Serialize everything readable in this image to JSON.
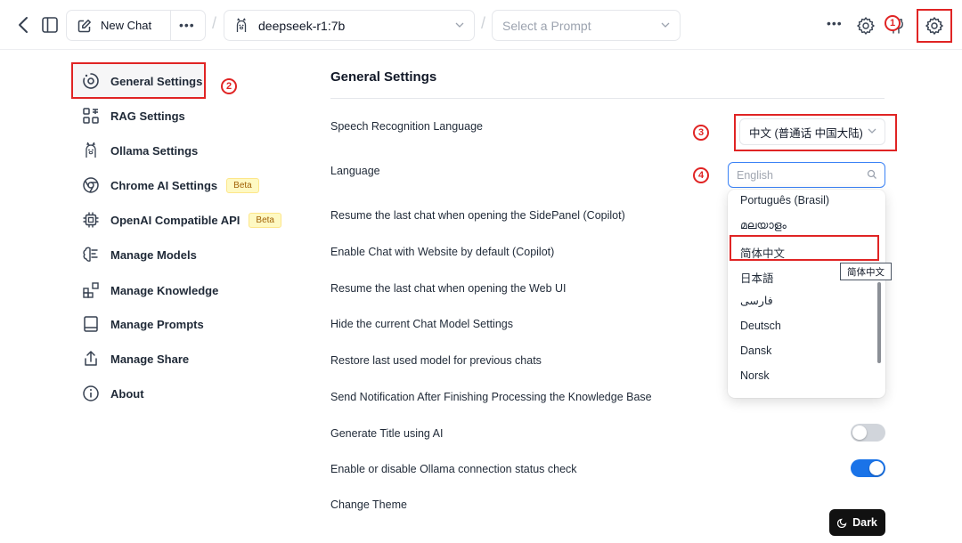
{
  "topbar": {
    "new_chat_label": "New Chat",
    "more_label": "•••",
    "model_label": "deepseek-r1:7b",
    "prompt_placeholder": "Select a Prompt",
    "overflow_label": "•••"
  },
  "annotations": {
    "one": "1",
    "two": "2",
    "three": "3",
    "four": "4"
  },
  "nav": {
    "items": [
      {
        "label": "General Settings",
        "icon": "general-settings-icon"
      },
      {
        "label": "RAG Settings",
        "icon": "rag-icon"
      },
      {
        "label": "Ollama Settings",
        "icon": "ollama-icon"
      },
      {
        "label": "Chrome AI Settings",
        "icon": "chrome-icon",
        "badge": "Beta"
      },
      {
        "label": "OpenAI Compatible API",
        "icon": "chip-icon",
        "badge": "Beta"
      },
      {
        "label": "Manage Models",
        "icon": "brain-icon"
      },
      {
        "label": "Manage Knowledge",
        "icon": "blocks-icon"
      },
      {
        "label": "Manage Prompts",
        "icon": "book-icon"
      },
      {
        "label": "Manage Share",
        "icon": "share-icon"
      },
      {
        "label": "About",
        "icon": "info-icon"
      }
    ]
  },
  "main": {
    "title": "General Settings",
    "settings": [
      {
        "label": "Speech Recognition Language"
      },
      {
        "label": "Language"
      },
      {
        "label": "Resume the last chat when opening the SidePanel (Copilot)"
      },
      {
        "label": "Enable Chat with Website by default (Copilot)"
      },
      {
        "label": "Resume the last chat when opening the Web UI"
      },
      {
        "label": "Hide the current Chat Model Settings"
      },
      {
        "label": "Restore last used model for previous chats"
      },
      {
        "label": "Send Notification After Finishing Processing the Knowledge Base"
      },
      {
        "label": "Generate Title using AI",
        "toggle": false
      },
      {
        "label": "Enable or disable Ollama connection status check",
        "toggle": true
      },
      {
        "label": "Change Theme"
      }
    ],
    "speech_value": "中文 (普通话 中国大陆)",
    "language_placeholder": "English",
    "language_options": [
      "Português (Brasil)",
      "മലയാളം",
      "简体中文",
      "日本語",
      "فارسی",
      "Deutsch",
      "Dansk",
      "Norsk"
    ],
    "highlighted_option": "简体中文",
    "tooltip": "简体中文",
    "theme_button": "Dark"
  },
  "colors": {
    "annotation": "#e02424",
    "toggle_on": "#1a73e8",
    "toggle_off": "#d1d5db",
    "theme_btn": "#111111"
  }
}
